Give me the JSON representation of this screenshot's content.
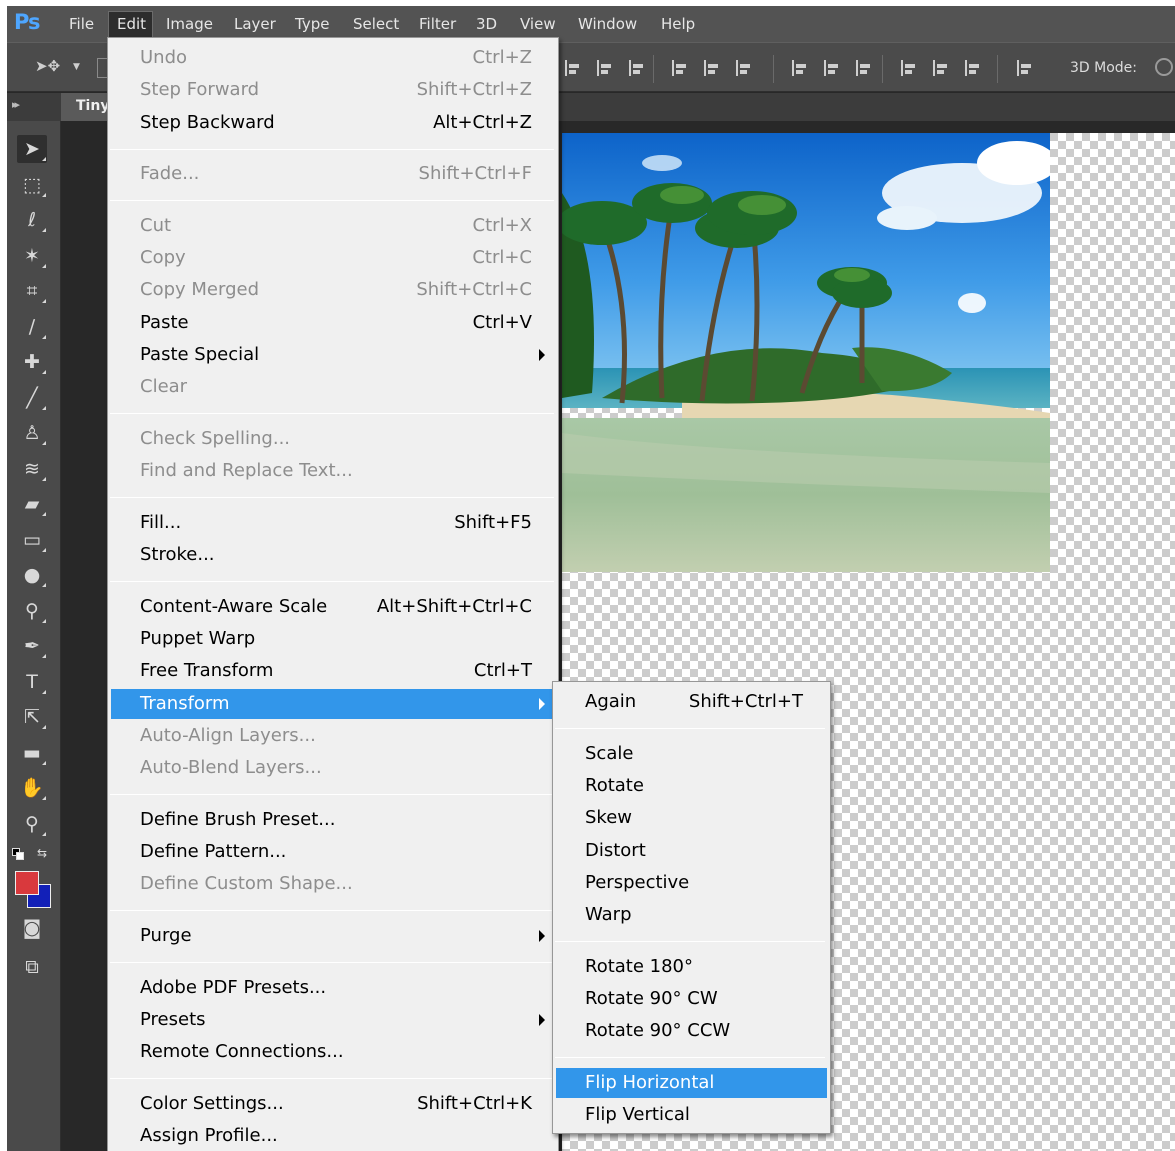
{
  "app": {
    "logo": "Ps",
    "menubar": [
      "File",
      "Edit",
      "Image",
      "Layer",
      "Type",
      "Select",
      "Filter",
      "3D",
      "View",
      "Window",
      "Help"
    ],
    "options_3d_label": "3D Mode:",
    "document_tab": "Tiny"
  },
  "colors": {
    "menu_highlight": "#3296ea",
    "foreground_color": "#d9393d",
    "background_color": "#1220b8",
    "logo_blue": "#4ea6ff"
  },
  "edit_menu": [
    {
      "label": "Undo",
      "shortcut": "Ctrl+Z",
      "disabled": true
    },
    {
      "label": "Step Forward",
      "shortcut": "Shift+Ctrl+Z",
      "disabled": true
    },
    {
      "label": "Step Backward",
      "shortcut": "Alt+Ctrl+Z"
    },
    {
      "sep": true
    },
    {
      "label": "Fade...",
      "shortcut": "Shift+Ctrl+F",
      "disabled": true
    },
    {
      "sep": true
    },
    {
      "label": "Cut",
      "shortcut": "Ctrl+X",
      "disabled": true
    },
    {
      "label": "Copy",
      "shortcut": "Ctrl+C",
      "disabled": true
    },
    {
      "label": "Copy Merged",
      "shortcut": "Shift+Ctrl+C",
      "disabled": true
    },
    {
      "label": "Paste",
      "shortcut": "Ctrl+V"
    },
    {
      "label": "Paste Special",
      "submenu": true
    },
    {
      "label": "Clear",
      "disabled": true
    },
    {
      "sep": true
    },
    {
      "label": "Check Spelling...",
      "disabled": true
    },
    {
      "label": "Find and Replace Text...",
      "disabled": true
    },
    {
      "sep": true
    },
    {
      "label": "Fill...",
      "shortcut": "Shift+F5"
    },
    {
      "label": "Stroke..."
    },
    {
      "sep": true
    },
    {
      "label": "Content-Aware Scale",
      "shortcut": "Alt+Shift+Ctrl+C"
    },
    {
      "label": "Puppet Warp"
    },
    {
      "label": "Free Transform",
      "shortcut": "Ctrl+T"
    },
    {
      "label": "Transform",
      "submenu": true,
      "highlighted": true
    },
    {
      "label": "Auto-Align Layers...",
      "disabled": true
    },
    {
      "label": "Auto-Blend Layers...",
      "disabled": true
    },
    {
      "sep": true
    },
    {
      "label": "Define Brush Preset..."
    },
    {
      "label": "Define Pattern..."
    },
    {
      "label": "Define Custom Shape...",
      "disabled": true
    },
    {
      "sep": true
    },
    {
      "label": "Purge",
      "submenu": true
    },
    {
      "sep": true
    },
    {
      "label": "Adobe PDF Presets..."
    },
    {
      "label": "Presets",
      "submenu": true
    },
    {
      "label": "Remote Connections..."
    },
    {
      "sep": true
    },
    {
      "label": "Color Settings...",
      "shortcut": "Shift+Ctrl+K"
    },
    {
      "label": "Assign Profile..."
    }
  ],
  "transform_menu": [
    {
      "label": "Again",
      "shortcut": "Shift+Ctrl+T"
    },
    {
      "sep": true
    },
    {
      "label": "Scale"
    },
    {
      "label": "Rotate"
    },
    {
      "label": "Skew"
    },
    {
      "label": "Distort"
    },
    {
      "label": "Perspective"
    },
    {
      "label": "Warp"
    },
    {
      "sep": true
    },
    {
      "label": "Rotate 180°"
    },
    {
      "label": "Rotate 90° CW"
    },
    {
      "label": "Rotate 90° CCW"
    },
    {
      "sep": true
    },
    {
      "label": "Flip Horizontal",
      "highlighted": true
    },
    {
      "label": "Flip Vertical"
    }
  ],
  "tools": [
    {
      "icon": "move-tool-icon",
      "glyph": "➤"
    },
    {
      "icon": "marquee-tool-icon",
      "glyph": "⬚"
    },
    {
      "icon": "lasso-tool-icon",
      "glyph": "ℓ"
    },
    {
      "icon": "magic-wand-tool-icon",
      "glyph": "✶"
    },
    {
      "icon": "crop-tool-icon",
      "glyph": "⌗"
    },
    {
      "icon": "eyedropper-tool-icon",
      "glyph": "∕"
    },
    {
      "icon": "healing-brush-tool-icon",
      "glyph": "✚"
    },
    {
      "icon": "brush-tool-icon",
      "glyph": "╱"
    },
    {
      "icon": "clone-stamp-tool-icon",
      "glyph": "♙"
    },
    {
      "icon": "history-brush-tool-icon",
      "glyph": "≋"
    },
    {
      "icon": "eraser-tool-icon",
      "glyph": "▰"
    },
    {
      "icon": "gradient-tool-icon",
      "glyph": "▭"
    },
    {
      "icon": "blur-tool-icon",
      "glyph": "●"
    },
    {
      "icon": "dodge-tool-icon",
      "glyph": "⚲"
    },
    {
      "icon": "pen-tool-icon",
      "glyph": "✒"
    },
    {
      "icon": "type-tool-icon",
      "glyph": "T"
    },
    {
      "icon": "path-selection-tool-icon",
      "glyph": "⇱"
    },
    {
      "icon": "rectangle-tool-icon",
      "glyph": "▬"
    },
    {
      "icon": "hand-tool-icon",
      "glyph": "✋"
    },
    {
      "icon": "zoom-tool-icon",
      "glyph": "⚲"
    }
  ],
  "tools_bottom": [
    {
      "icon": "quick-mask-icon",
      "glyph": "◙"
    },
    {
      "icon": "screen-mode-icon",
      "glyph": "⧉"
    }
  ],
  "canvas_image": "tropical-beach-photo"
}
